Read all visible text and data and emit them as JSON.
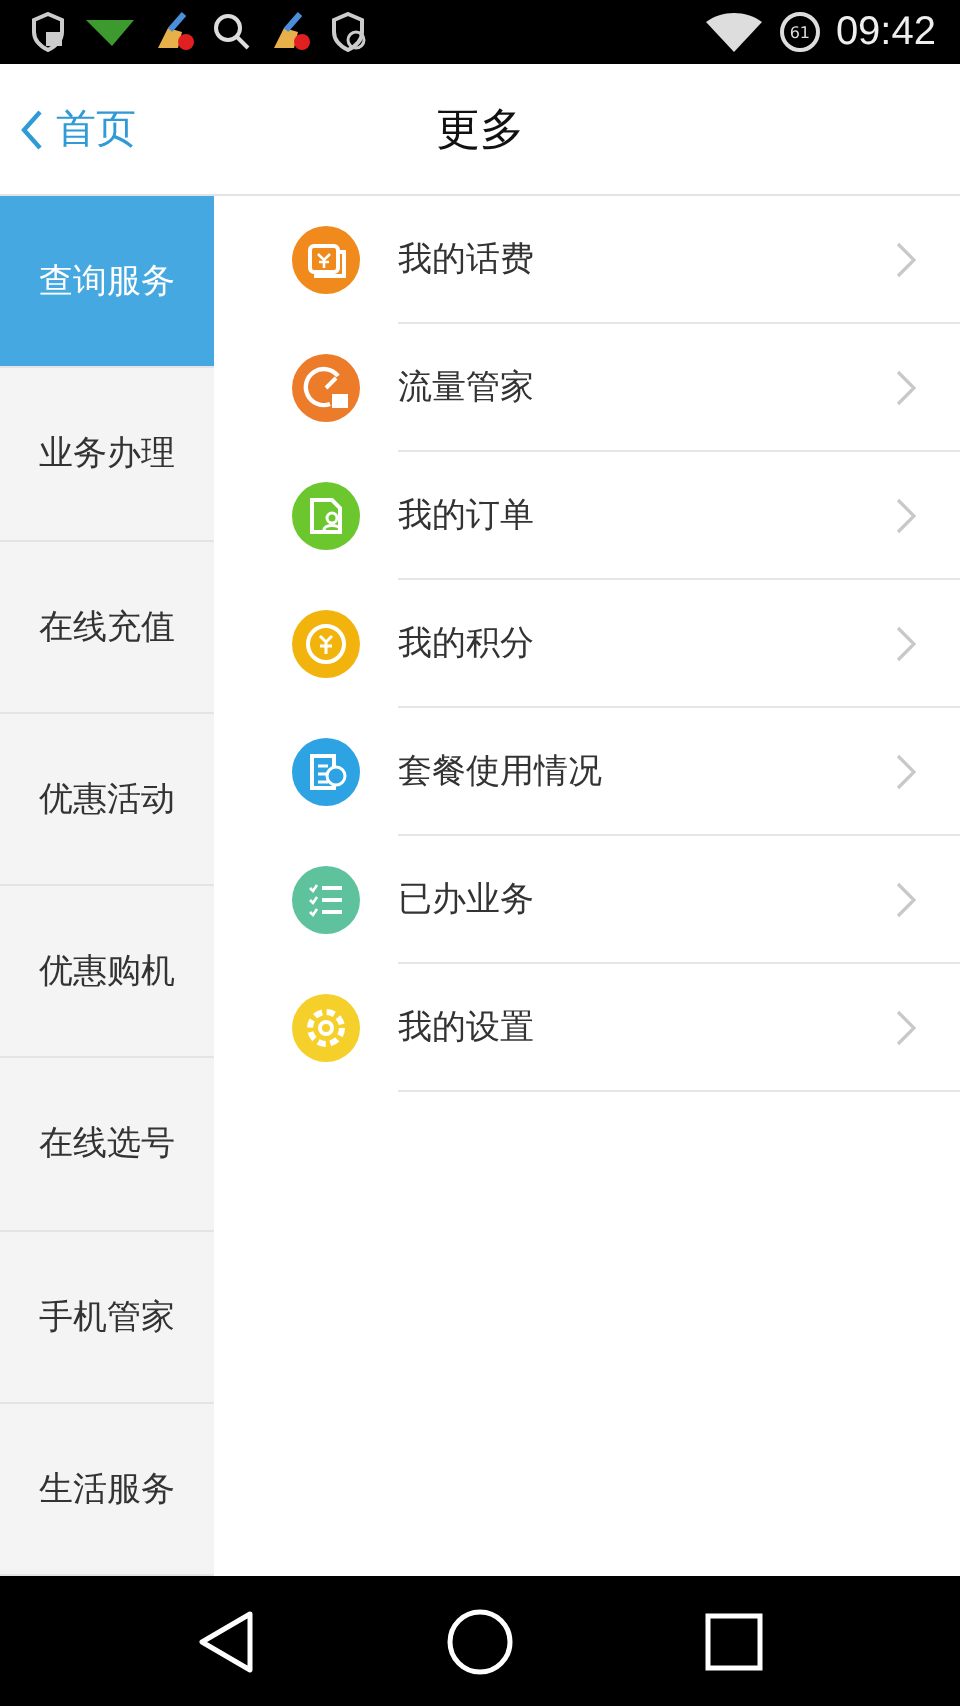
{
  "status_bar": {
    "battery": "61",
    "time": "09:42"
  },
  "header": {
    "back": "首页",
    "title": "更多"
  },
  "sidebar": {
    "items": [
      {
        "label": "查询服务",
        "selected": true
      },
      {
        "label": "业务办理",
        "selected": false
      },
      {
        "label": "在线充值",
        "selected": false
      },
      {
        "label": "优惠活动",
        "selected": false
      },
      {
        "label": "优惠购机",
        "selected": false
      },
      {
        "label": "在线选号",
        "selected": false
      },
      {
        "label": "手机管家",
        "selected": false
      },
      {
        "label": "生活服务",
        "selected": false
      }
    ]
  },
  "menu": [
    {
      "label": "我的话费",
      "color": "#f08a1c"
    },
    {
      "label": "流量管家",
      "color": "#ec7b2a"
    },
    {
      "label": "我的订单",
      "color": "#6cc72e"
    },
    {
      "label": "我的积分",
      "color": "#f2b40c"
    },
    {
      "label": "套餐使用情况",
      "color": "#2ea3e3"
    },
    {
      "label": "已办业务",
      "color": "#5ec29d"
    },
    {
      "label": "我的设置",
      "color": "#f5cf2a"
    }
  ]
}
